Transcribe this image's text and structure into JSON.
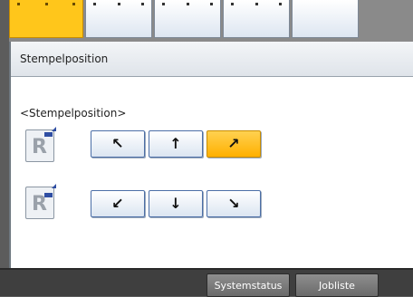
{
  "panel": {
    "title": "Stempelposition",
    "section_label": "<Stempelposition>"
  },
  "positions": {
    "top_left": {
      "icon": "arrow-up-left-icon",
      "glyph": "↖"
    },
    "top_center": {
      "icon": "arrow-up-icon",
      "glyph": "↑"
    },
    "top_right": {
      "icon": "arrow-up-right-icon",
      "glyph": "↗",
      "selected": true
    },
    "bottom_left": {
      "icon": "arrow-down-left-icon",
      "glyph": "↙"
    },
    "bottom_center": {
      "icon": "arrow-down-icon",
      "glyph": "↓"
    },
    "bottom_right": {
      "icon": "arrow-down-right-icon",
      "glyph": "↘"
    }
  },
  "footer": {
    "system_status_label": "Systemstatus",
    "job_list_label": "Jobliste"
  },
  "colors": {
    "selected": "#ffb000",
    "button_border": "#4c6fa7",
    "bottom_bar": "#3f3f3f"
  }
}
